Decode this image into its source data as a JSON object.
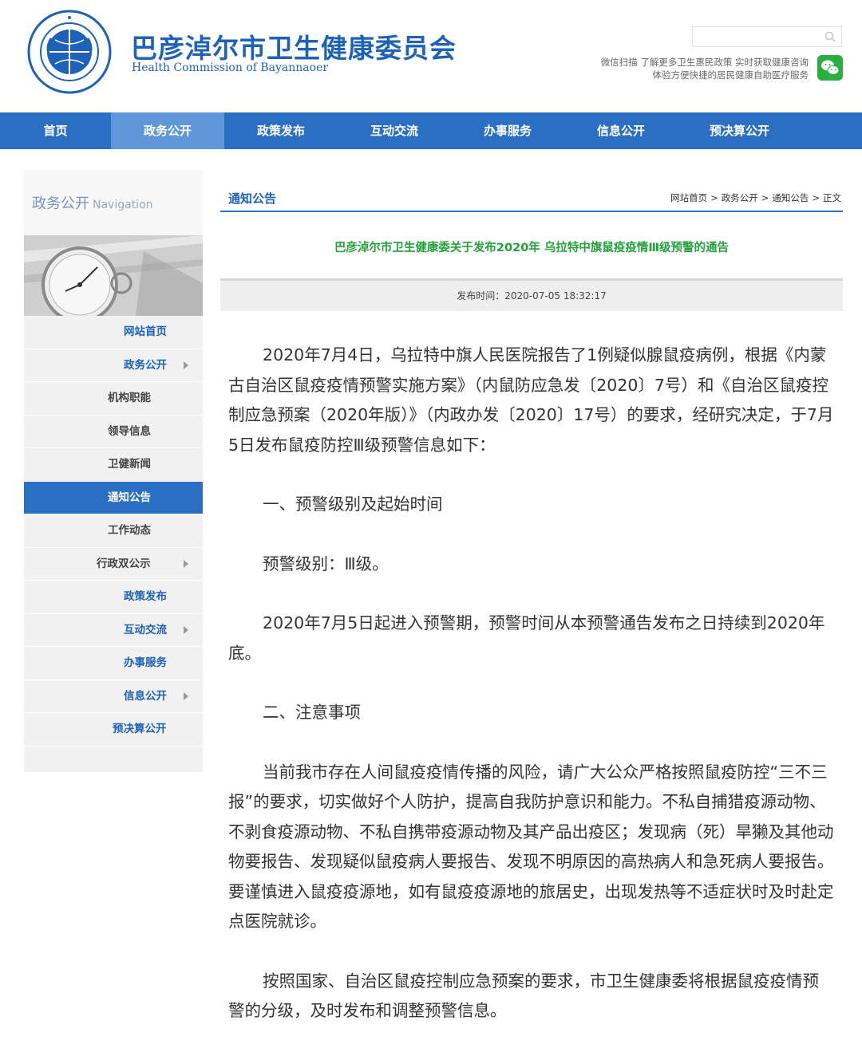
{
  "header": {
    "title": "巴彦淖尔市卫生健康委员会",
    "subtitle": "Health Commission of Bayannaoer",
    "wechat_line1": "微信扫描 了解更多卫生惠民政策 实时获取健康咨询",
    "wechat_line2": "体验方便快捷的居民健康自助医疗服务",
    "search_placeholder": ""
  },
  "nav": {
    "items": [
      {
        "label": "首页"
      },
      {
        "label": "政务公开"
      },
      {
        "label": "政策发布"
      },
      {
        "label": "互动交流"
      },
      {
        "label": "办事服务"
      },
      {
        "label": "信息公开"
      },
      {
        "label": "预决算公开"
      }
    ],
    "active_index": 1
  },
  "sidebar": {
    "title_cn": "政务公开",
    "title_en": "Navigation",
    "items": [
      {
        "label": "网站首页"
      },
      {
        "label": "政务公开"
      },
      {
        "label": "机构职能"
      },
      {
        "label": "领导信息"
      },
      {
        "label": "卫健新闻"
      },
      {
        "label": "通知公告"
      },
      {
        "label": "工作动态"
      },
      {
        "label": "行政双公示"
      },
      {
        "label": "政策发布"
      },
      {
        "label": "互动交流"
      },
      {
        "label": "办事服务"
      },
      {
        "label": "信息公开"
      },
      {
        "label": "预决算公开"
      }
    ]
  },
  "main": {
    "section_title": "通知公告",
    "breadcrumb": [
      "网站首页",
      "政务公开",
      "通知公告",
      "正文"
    ],
    "breadcrumb_sep": ">",
    "article_title": "巴彦淖尔市卫生健康委关于发布2020年 乌拉特中旗鼠疫疫情Ⅲ级预警的通告",
    "publish_time": "发布时间：2020-07-05 18:32:17",
    "paragraphs": [
      "2020年7月4日，乌拉特中旗人民医院报告了1例疑似腺鼠疫病例，根据《内蒙古自治区鼠疫疫情预警实施方案》（内鼠防应急发〔2020〕7号）和《自治区鼠疫控制应急预案（2020年版）》（内政办发〔2020〕17号）的要求，经研究决定，于7月5日发布鼠疫防控Ⅲ级预警信息如下：",
      "一、预警级别及起始时间",
      "预警级别：Ⅲ级。",
      "2020年7月5日起进入预警期，预警时间从本预警通告发布之日持续到2020年底。",
      "二、注意事项",
      "当前我市存在人间鼠疫疫情传播的风险，请广大公众严格按照鼠疫防控“三不三报”的要求，切实做好个人防护，提高自我防护意识和能力。不私自捕猎疫源动物、不剥食疫源动物、不私自携带疫源动物及其产品出疫区；发现病（死）旱獭及其他动物要报告、发现疑似鼠疫病人要报告、发现不明原因的高热病人和急死病人要报告。要谨慎进入鼠疫疫源地，如有鼠疫疫源地的旅居史，出现发热等不适症状时及时赴定点医院就诊。",
      "按照国家、自治区鼠疫控制应急预案的要求，市卫生健康委将根据鼠疫疫情预警的分级，及时发布和调整预警信息。"
    ]
  }
}
